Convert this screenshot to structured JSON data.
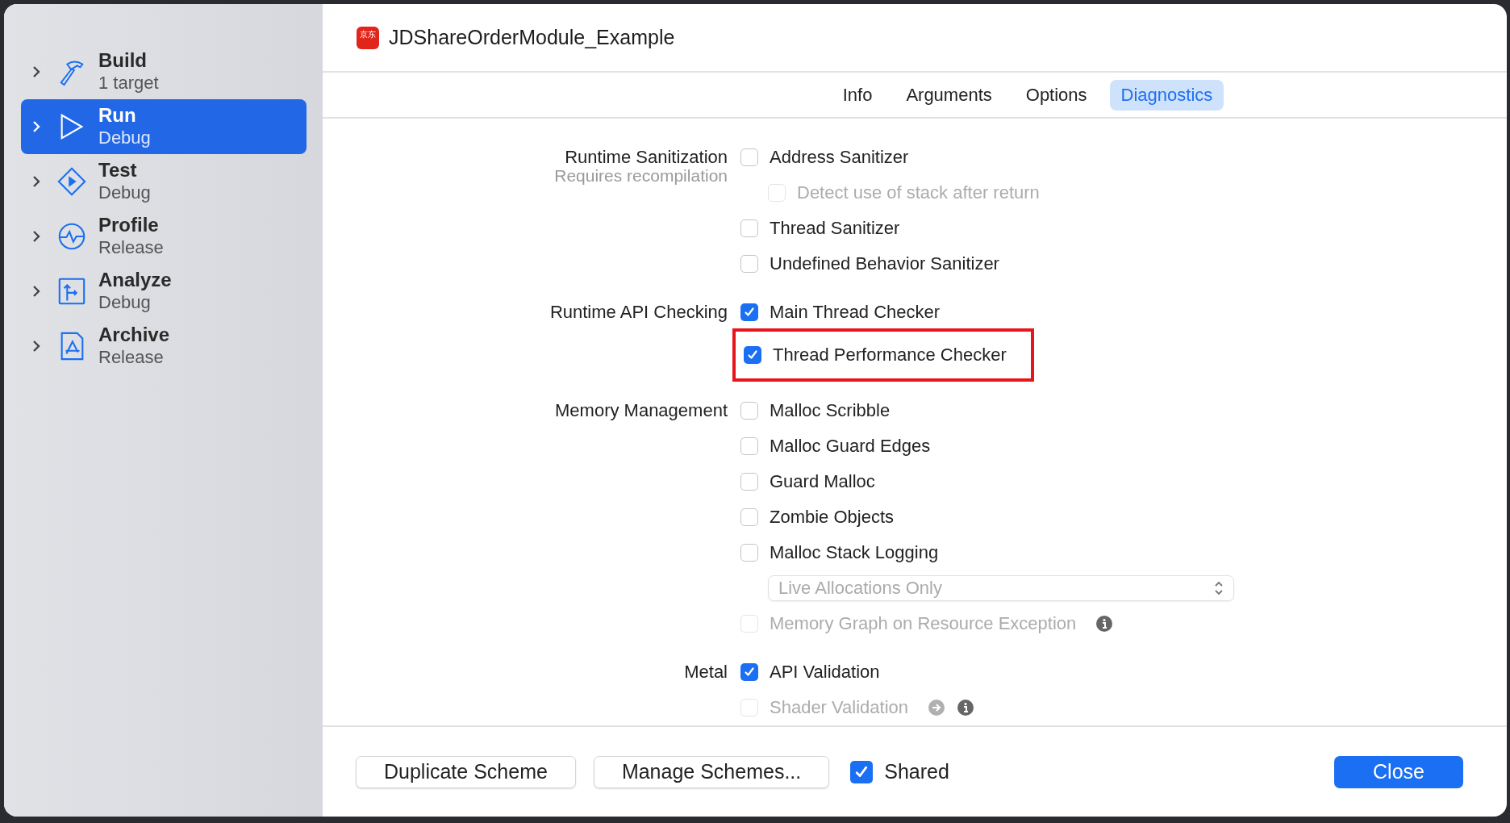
{
  "sidebar": {
    "items": [
      {
        "title": "Build",
        "subtitle": "1 target",
        "selected": false
      },
      {
        "title": "Run",
        "subtitle": "Debug",
        "selected": true
      },
      {
        "title": "Test",
        "subtitle": "Debug",
        "selected": false
      },
      {
        "title": "Profile",
        "subtitle": "Release",
        "selected": false
      },
      {
        "title": "Analyze",
        "subtitle": "Debug",
        "selected": false
      },
      {
        "title": "Archive",
        "subtitle": "Release",
        "selected": false
      }
    ]
  },
  "header": {
    "title": "JDShareOrderModule_Example",
    "app_icon_text": "京东"
  },
  "tabs": [
    {
      "label": "Info",
      "selected": false
    },
    {
      "label": "Arguments",
      "selected": false
    },
    {
      "label": "Options",
      "selected": false
    },
    {
      "label": "Diagnostics",
      "selected": true
    }
  ],
  "sections": [
    {
      "label": "Runtime Sanitization",
      "note": "Requires recompilation",
      "options": [
        {
          "kind": "checkbox",
          "label": "Address Sanitizer",
          "checked": false,
          "disabled": false,
          "children": [
            {
              "kind": "checkbox",
              "label": "Detect use of stack after return",
              "checked": false,
              "disabled": true
            }
          ]
        },
        {
          "kind": "checkbox",
          "label": "Thread Sanitizer",
          "checked": false,
          "disabled": false
        },
        {
          "kind": "checkbox",
          "label": "Undefined Behavior Sanitizer",
          "checked": false,
          "disabled": false
        }
      ]
    },
    {
      "label": "Runtime API Checking",
      "options": [
        {
          "kind": "checkbox",
          "label": "Main Thread Checker",
          "checked": true,
          "disabled": false
        },
        {
          "kind": "checkbox",
          "label": "Thread Performance Checker",
          "checked": true,
          "disabled": false,
          "highlighted": true
        }
      ]
    },
    {
      "label": "Memory Management",
      "options": [
        {
          "kind": "checkbox",
          "label": "Malloc Scribble",
          "checked": false,
          "disabled": false
        },
        {
          "kind": "checkbox",
          "label": "Malloc Guard Edges",
          "checked": false,
          "disabled": false
        },
        {
          "kind": "checkbox",
          "label": "Guard Malloc",
          "checked": false,
          "disabled": false
        },
        {
          "kind": "checkbox",
          "label": "Zombie Objects",
          "checked": false,
          "disabled": false
        },
        {
          "kind": "checkbox",
          "label": "Malloc Stack Logging",
          "checked": false,
          "disabled": false,
          "children": [
            {
              "kind": "select",
              "value": "Live Allocations Only",
              "disabled": true
            }
          ]
        },
        {
          "kind": "checkbox",
          "label": "Memory Graph on Resource Exception",
          "checked": false,
          "disabled": true,
          "info": true
        }
      ]
    },
    {
      "label": "Metal",
      "options": [
        {
          "kind": "checkbox",
          "label": "API Validation",
          "checked": true,
          "disabled": false
        },
        {
          "kind": "checkbox",
          "label": "Shader Validation",
          "checked": false,
          "disabled": true,
          "info": true,
          "link": true
        }
      ]
    }
  ],
  "footer": {
    "buttons": [
      "Duplicate Scheme",
      "Manage Schemes..."
    ],
    "shared": {
      "label": "Shared",
      "checked": true
    },
    "close": "Close"
  }
}
